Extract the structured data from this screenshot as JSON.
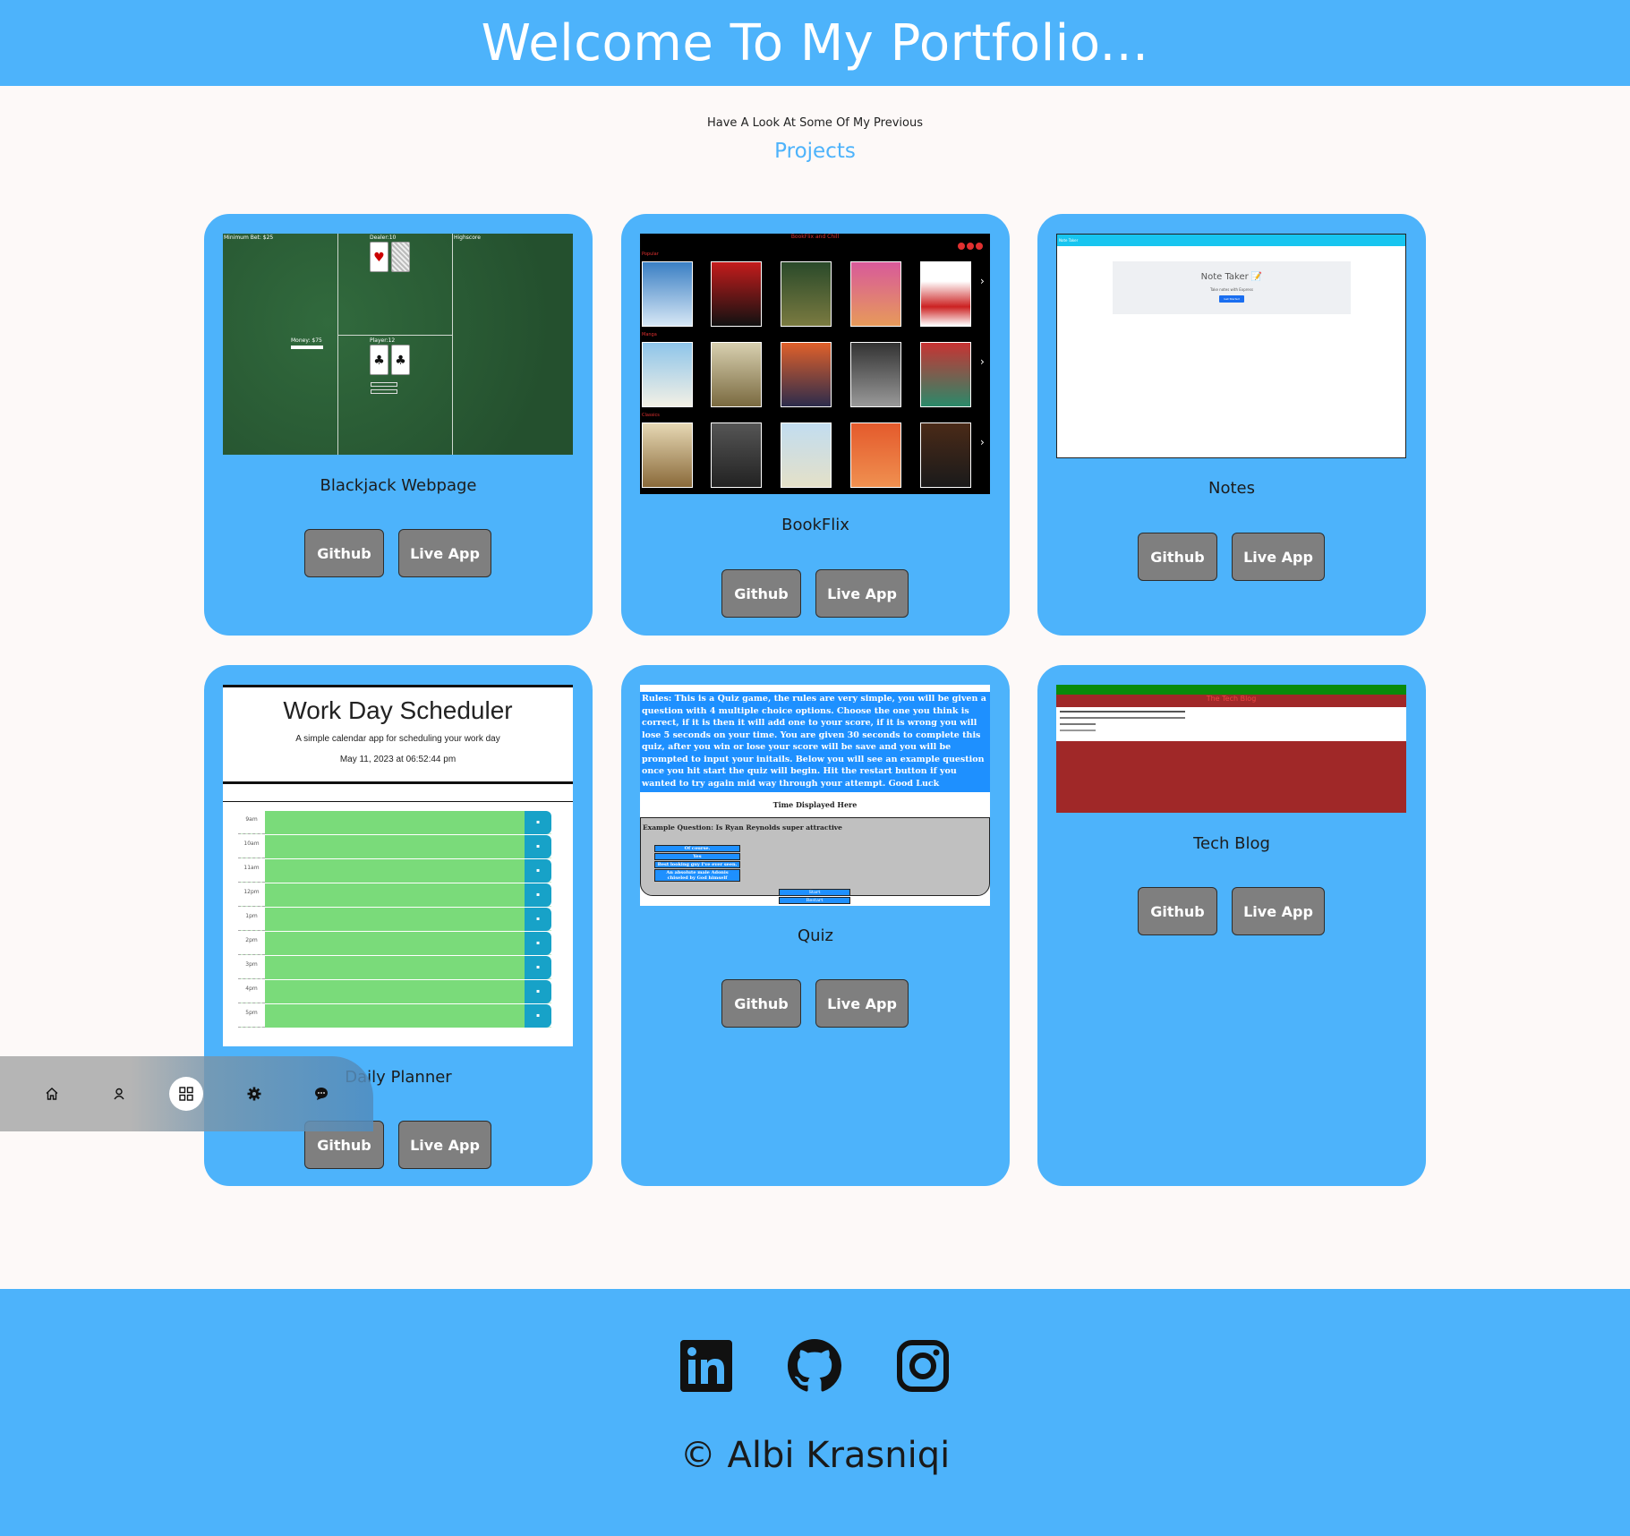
{
  "header": {
    "title": "Welcome To My Portfolio..."
  },
  "intro": {
    "subtitle": "Have A Look At Some Of My Previous",
    "title": "Projects"
  },
  "projects": [
    {
      "title": "Blackjack Webpage",
      "github": "Github",
      "live": "Live App"
    },
    {
      "title": "BookFlix",
      "github": "Github",
      "live": "Live App"
    },
    {
      "title": "Notes",
      "github": "Github",
      "live": "Live App"
    },
    {
      "title": "Daily Planner",
      "github": "Github",
      "live": "Live App"
    },
    {
      "title": "Quiz",
      "github": "Github",
      "live": "Live App"
    },
    {
      "title": "Tech Blog",
      "github": "Github",
      "live": "Live App"
    }
  ],
  "blackjack_shot": {
    "min_bet": "Minimum Bet: $25",
    "dealer": "Dealer:10",
    "highscore": "Highscore",
    "money": "Money: $75",
    "player": "Player:12"
  },
  "bookflix_shot": {
    "title": "BookFlix and Chill",
    "row_labels": [
      "Popular",
      "Manga",
      "Classics"
    ]
  },
  "notes_shot": {
    "bar": "Note Taker",
    "heading": "Note Taker 📝",
    "sub": "Take notes with Express",
    "button": "Get Started"
  },
  "scheduler_shot": {
    "title": "Work Day Scheduler",
    "subtitle": "A simple calendar app for scheduling your work day",
    "date": "May 11, 2023 at 06:52:44 pm",
    "hours": [
      "9am",
      "10am",
      "11am",
      "12pm",
      "1pm",
      "2pm",
      "3pm",
      "4pm",
      "5pm"
    ]
  },
  "quiz_shot": {
    "rules": "Rules: This is a Quiz game, the rules are very simple, you will be given a question with 4 multiple choice options. Choose the one you think is correct, if it is then it will add one to your score, if it is wrong you will lose 5 seconds on your time. You are given 30 seconds to complete this quiz, after you win or lose your score will be save and you will be prompted to input your initails. Below you will see an example question once you hit start the quiz will begin. Hit the restart button if you wanted to try again mid way through your attempt. Good Luck",
    "time": "Time Displayed Here",
    "question": "Example Question: Is Ryan Reynolds super attractive",
    "options": [
      "Of course.",
      "Yes",
      "Best looking guy I've ever seen.",
      "An absolute male Adonis chiseled by God himself"
    ],
    "start": "Start",
    "restart": "Restart"
  },
  "techblog_shot": {
    "title": "The Tech Blog"
  },
  "floating_nav": [
    "home-icon",
    "user-icon",
    "grid-icon",
    "gear-icon",
    "chat-icon"
  ],
  "footer": {
    "social": [
      "linkedin-icon",
      "github-icon",
      "instagram-icon"
    ],
    "copyright": "© Albi Krasniqi"
  },
  "colors": {
    "primary": "#4db3fb",
    "button": "#7f7f7f",
    "background": "#fdf9f8"
  }
}
